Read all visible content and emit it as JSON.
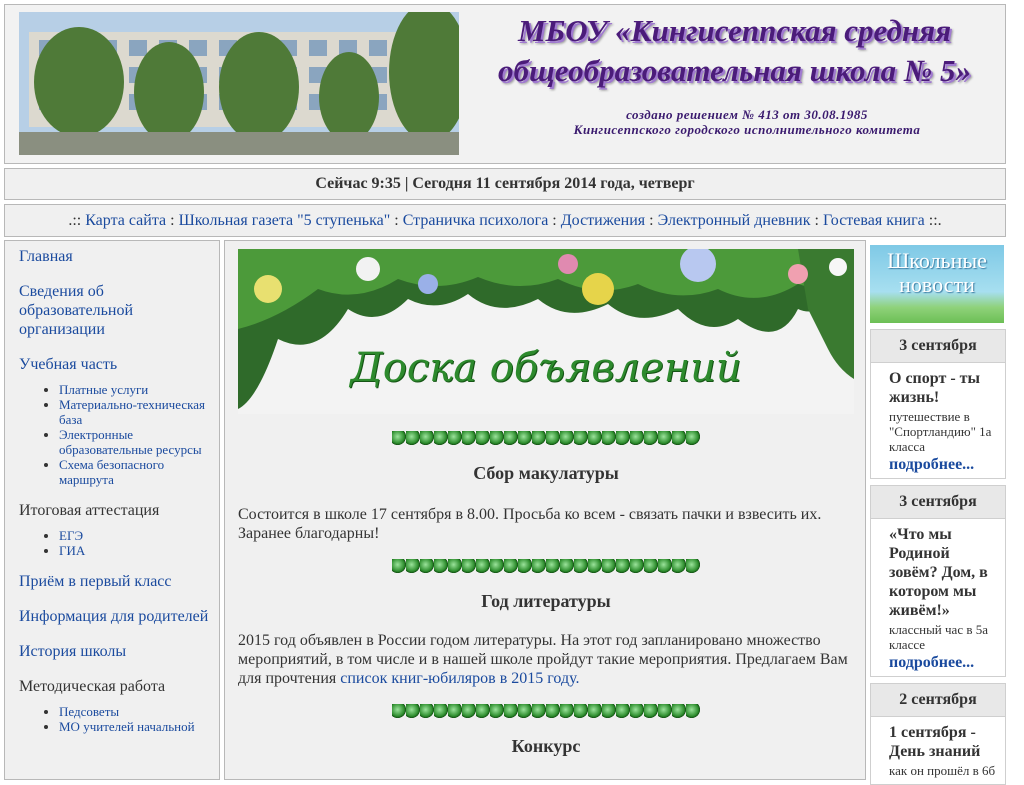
{
  "header": {
    "title_line1": "МБОУ «Кингисеппская средняя",
    "title_line2": "общеобразовательная школа № 5»",
    "subtitle_line1": "создано решением № 413 от 30.08.1985",
    "subtitle_line2": "Кингисеппского городского исполнительного комитета"
  },
  "datebar": {
    "text": "Сейчас 9:35 | Сегодня 11 сентября 2014 года, четверг"
  },
  "nav": {
    "prefix": ".:: ",
    "suffix": " ::.",
    "sep": " : ",
    "items": [
      "Карта сайта",
      "Школьная газета \"5 ступенька\"",
      "Страничка психолога",
      "Достижения",
      "Электронный дневник",
      "Гостевая книга"
    ]
  },
  "sidebar": {
    "main": "Главная",
    "org_info": "Сведения об образовательной организации",
    "study": "Учебная часть",
    "study_sub": [
      "Платные услуги",
      "Материально-техническая база",
      "Электронные образовательные ресурсы",
      "Схема безопасного маршрута"
    ],
    "attestation": "Итоговая аттестация",
    "attestation_sub": [
      "ЕГЭ",
      "ГИА"
    ],
    "first_grade": "Приём в первый класс",
    "parents": "Информация для родителей",
    "history": "История школы",
    "method": "Методическая работа",
    "method_sub": [
      "Педсоветы",
      "МО учителей начальной"
    ]
  },
  "center": {
    "banner_title": "Доска объявлений",
    "news": [
      {
        "title": "Сбор макулатуры",
        "body": "Состоится в школе 17 сентября в 8.00. Просьба ко всем - связать пачки и взвесить их. Заранее благодарны!"
      },
      {
        "title": "Год литературы",
        "body": "2015 год объявлен в России годом литературы. На этот год запланировано множество мероприятий, в том числе и в нашей школе пройдут такие мероприятия. Предлагаем Вам для прочтения ",
        "link": "список книг-юбиляров в 2015 году."
      },
      {
        "title": "Конкурс"
      }
    ]
  },
  "right": {
    "banner_line1": "Школьные",
    "banner_line2": "новости",
    "more_label": "подробнее...",
    "items": [
      {
        "date": "3 сентября",
        "head": "О спорт - ты жизнь!",
        "text": "путешествие в \"Спортландию\" 1а класса"
      },
      {
        "date": "3 сентября",
        "head": "«Что мы Родиной зовём? Дом, в котором мы живём!»",
        "text": "классный час в 5а классе"
      },
      {
        "date": "2 сентября",
        "head": "1 сентября - День знаний",
        "text": "как он прошёл в 6б"
      }
    ]
  }
}
